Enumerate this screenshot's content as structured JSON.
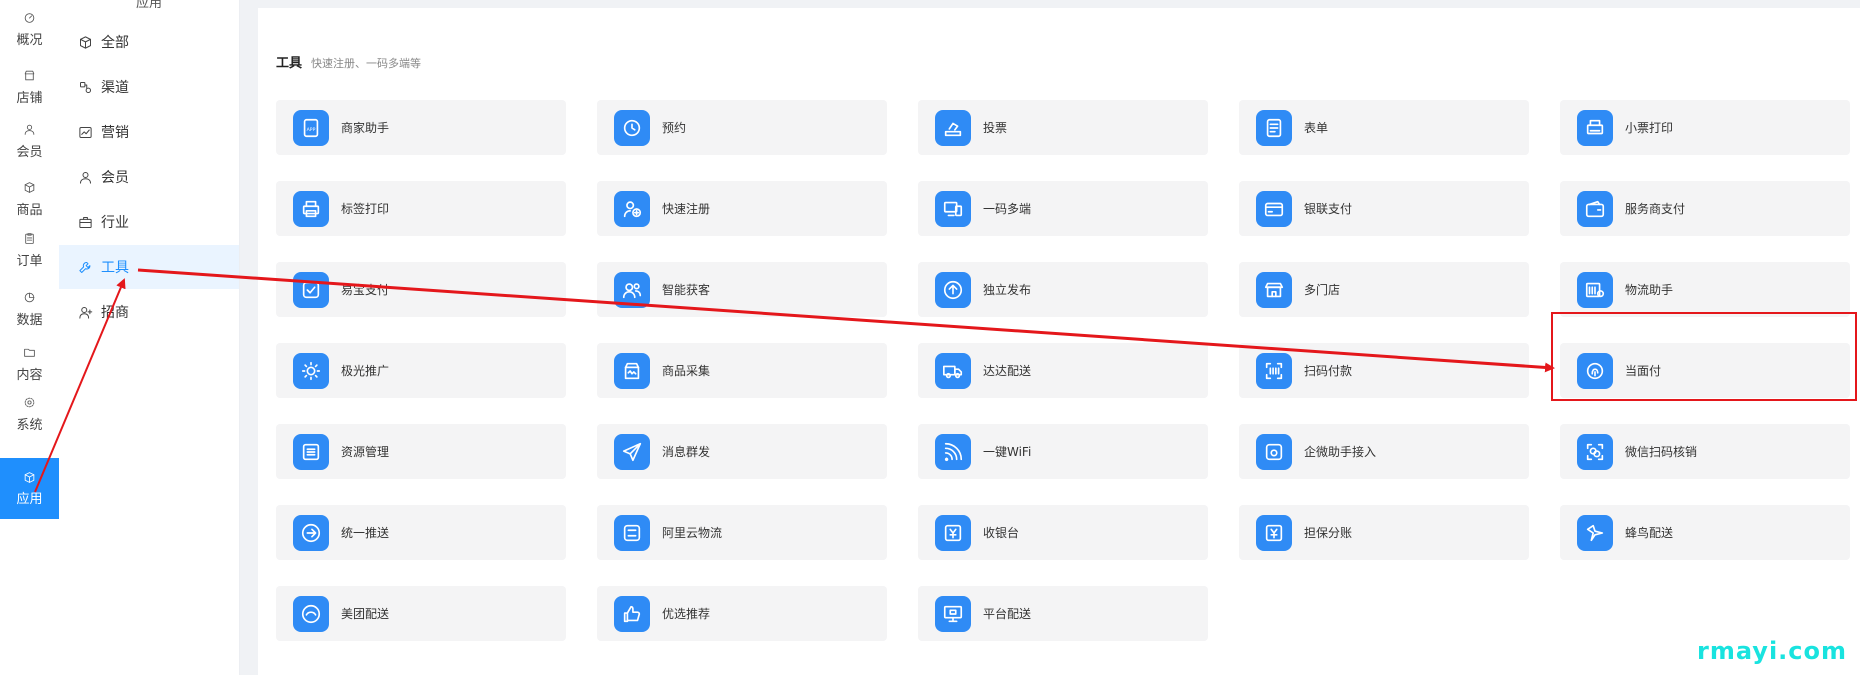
{
  "rail": {
    "items": [
      {
        "label": "概况",
        "icon": "dashboard-icon"
      },
      {
        "label": "店铺",
        "icon": "store-icon"
      },
      {
        "label": "会员",
        "icon": "user-icon"
      },
      {
        "label": "商品",
        "icon": "box-icon"
      },
      {
        "label": "订单",
        "icon": "clipboard-icon"
      },
      {
        "label": "数据",
        "icon": "pie-icon"
      },
      {
        "label": "内容",
        "icon": "folder-icon"
      },
      {
        "label": "系统",
        "icon": "gear-icon"
      },
      {
        "label": "应用",
        "icon": "cube-icon",
        "active": true
      }
    ]
  },
  "subnav": {
    "title": "应用",
    "items": [
      {
        "label": "全部",
        "icon": "cube-icon"
      },
      {
        "label": "渠道",
        "icon": "channel-icon"
      },
      {
        "label": "营销",
        "icon": "chart-line-icon"
      },
      {
        "label": "会员",
        "icon": "user-icon"
      },
      {
        "label": "行业",
        "icon": "briefcase-icon"
      },
      {
        "label": "工具",
        "icon": "wrench-icon",
        "active": true
      },
      {
        "label": "招商",
        "icon": "user-plus-icon"
      }
    ]
  },
  "section": {
    "title": "工具",
    "subtitle": "快速注册、一码多端等"
  },
  "tools": [
    {
      "label": "商家助手",
      "icon": "app-icon"
    },
    {
      "label": "预约",
      "icon": "clock-icon"
    },
    {
      "label": "投票",
      "icon": "vote-icon"
    },
    {
      "label": "表单",
      "icon": "form-icon"
    },
    {
      "label": "小票打印",
      "icon": "receipt-printer-icon"
    },
    {
      "label": "标签打印",
      "icon": "printer-icon"
    },
    {
      "label": "快速注册",
      "icon": "register-icon"
    },
    {
      "label": "一码多端",
      "icon": "multi-device-icon"
    },
    {
      "label": "银联支付",
      "icon": "card-icon"
    },
    {
      "label": "服务商支付",
      "icon": "wallet-icon"
    },
    {
      "label": "易宝支付",
      "icon": "check-pay-icon"
    },
    {
      "label": "智能获客",
      "icon": "users-icon"
    },
    {
      "label": "独立发布",
      "icon": "upload-icon"
    },
    {
      "label": "多门店",
      "icon": "shops-icon"
    },
    {
      "label": "物流助手",
      "icon": "logistics-icon"
    },
    {
      "label": "极光推广",
      "icon": "sun-icon"
    },
    {
      "label": "商品采集",
      "icon": "collect-icon"
    },
    {
      "label": "达达配送",
      "icon": "truck-icon"
    },
    {
      "label": "扫码付款",
      "icon": "scan-icon"
    },
    {
      "label": "当面付",
      "icon": "fingerprint-icon"
    },
    {
      "label": "资源管理",
      "icon": "list-icon"
    },
    {
      "label": "消息群发",
      "icon": "send-icon"
    },
    {
      "label": "一键WiFi",
      "icon": "wifi-icon"
    },
    {
      "label": "企微助手接入",
      "icon": "wecom-icon"
    },
    {
      "label": "微信扫码核销",
      "icon": "wechat-scan-icon"
    },
    {
      "label": "统一推送",
      "icon": "push-icon"
    },
    {
      "label": "阿里云物流",
      "icon": "aliyun-icon"
    },
    {
      "label": "收银台",
      "icon": "cashier-icon"
    },
    {
      "label": "担保分账",
      "icon": "guarantee-icon"
    },
    {
      "label": "蜂鸟配送",
      "icon": "bird-icon"
    },
    {
      "label": "美团配送",
      "icon": "meituan-icon"
    },
    {
      "label": "优选推荐",
      "icon": "thumb-up-icon"
    },
    {
      "label": "平台配送",
      "icon": "platform-icon"
    }
  ],
  "watermark": "rmayi.com",
  "colors": {
    "accent": "#1f8ffd",
    "tile": "#2f8bf5",
    "annotation": "#e4171b",
    "watermark": "#19e3df"
  }
}
